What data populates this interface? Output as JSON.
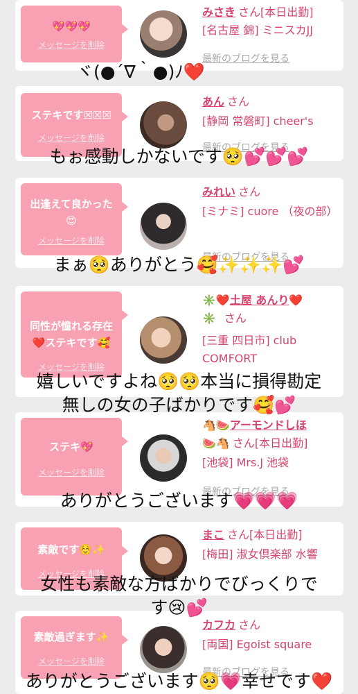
{
  "delete_label": "メッセージを削除",
  "blog_label": "最新のブログを見る",
  "san": "さん",
  "cards": [
    {
      "msg": "💖💖💖",
      "name": "みさき",
      "status": "[本日出勤]",
      "loc": "[名古屋 錦] ミニスカJJ"
    },
    {
      "msg": "ステキです☒☒☒",
      "name": "あん",
      "status": "",
      "loc": "[静岡 常磐町] cheer's"
    },
    {
      "msg": "出逢えて良かった",
      "msg2": "😍",
      "name": "みれい",
      "status": "",
      "loc": "[ミナミ] cuore （夜の部）"
    },
    {
      "msg": "同性が憧れる存在",
      "msg2": "❤️ステキです🥰",
      "name_prefix": "✳️❤️",
      "name": "土屋 あんり",
      "name_suffix": "❤️",
      "name2": "✳️",
      "status": "",
      "loc": "[三重 四日市] club COMFORT"
    },
    {
      "msg": "ステキ💖",
      "name_prefix": "🐴🍉",
      "name": "アーモンドしほ",
      "name2": "🍉🐴",
      "status": "[本日出勤]",
      "loc": "[池袋] Mrs.J 池袋"
    },
    {
      "msg": "素敵です☺️✨",
      "name": "まこ",
      "status": "[本日出勤]",
      "loc": "[梅田] 淑女倶楽部 水響"
    },
    {
      "msg": "素敵過ぎます✨",
      "name": "カフカ",
      "status": "",
      "loc": "[両国] Egoist square"
    }
  ],
  "captions": [
    "ヾ(●´∇｀●)ﾉ❤️",
    "もぉ感動しかないです🥺💕💕💕",
    "まぁ🥺ありがとう🥰✨✨✨💕",
    "嬉しいですよね🥺🥺本当に損得勘定",
    "無しの女の子ばかりです🥰💕",
    "ありがとうございます💗💗💗",
    "女性も素敵な方ばかりでびっくりで",
    "す😢💕",
    "ありがとうございます🥺💗幸せです❤️"
  ]
}
